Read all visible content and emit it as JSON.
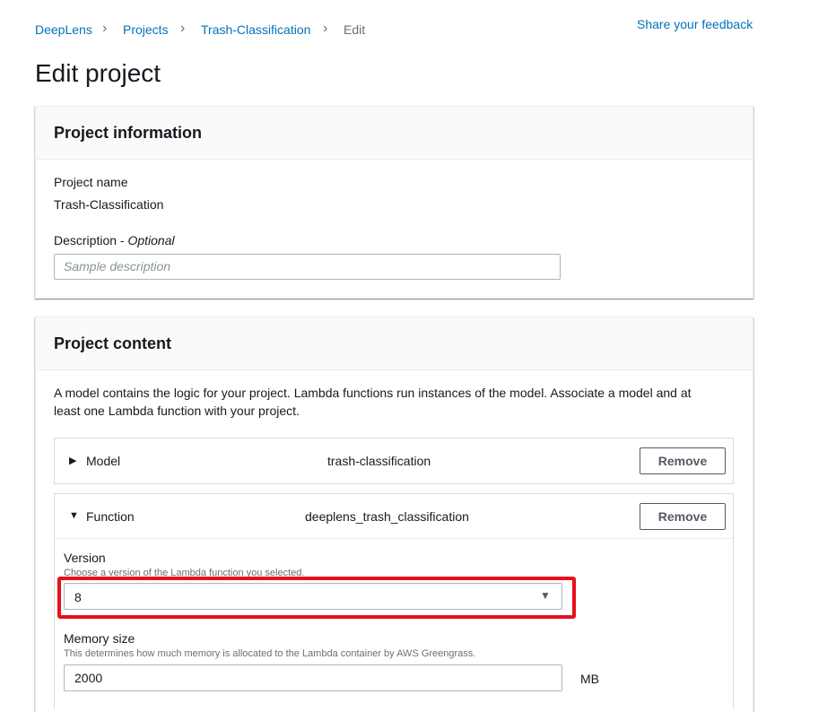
{
  "breadcrumb": {
    "items": [
      "DeepLens",
      "Projects",
      "Trash-Classification"
    ],
    "current": "Edit",
    "separator": "›"
  },
  "header": {
    "feedback_link": "Share your feedback",
    "title": "Edit project"
  },
  "project_info": {
    "heading": "Project information",
    "name_label": "Project name",
    "name_value": "Trash-Classification",
    "description_label": "Description - ",
    "description_optional": "Optional",
    "description_placeholder": "Sample description"
  },
  "project_content": {
    "heading": "Project content",
    "intro_line1": "A model contains the logic for your project. Lambda functions run instances of the model. Associate a model and at",
    "intro_line2": "least one Lambda function with your project.",
    "model": {
      "label": "Model",
      "value": "trash-classification",
      "remove_label": "Remove",
      "expanded": false
    },
    "function": {
      "label": "Function",
      "value": "deeplens_trash_classification",
      "remove_label": "Remove",
      "expanded": true,
      "version_label": "Version",
      "version_hint": "Choose a version of the Lambda function you selected.",
      "version_value": "8",
      "memory_label": "Memory size",
      "memory_hint": "This determines how much memory is allocated to the Lambda container by AWS Greengrass.",
      "memory_value": "2000",
      "memory_unit": "MB"
    }
  },
  "colors": {
    "link": "#0073bb",
    "highlight": "#e8101b",
    "text": "#16191f"
  }
}
